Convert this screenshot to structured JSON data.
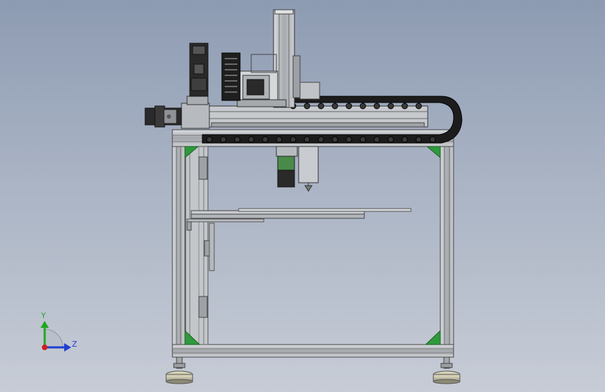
{
  "viewport": {
    "background_top": "#8d9bb2",
    "background_bottom": "#c7ccd6"
  },
  "model": {
    "frame_color": "#b4b8bd",
    "bracket_color": "#2e9a3c",
    "cable_chain_color": "#1c1c1c",
    "motor_color": "#2a2a2a"
  },
  "triad": {
    "y_label": "Y",
    "z_label": "Z",
    "y_color": "#1fa81f",
    "z_color": "#1f3fd0",
    "x_color": "#d01f1f"
  }
}
